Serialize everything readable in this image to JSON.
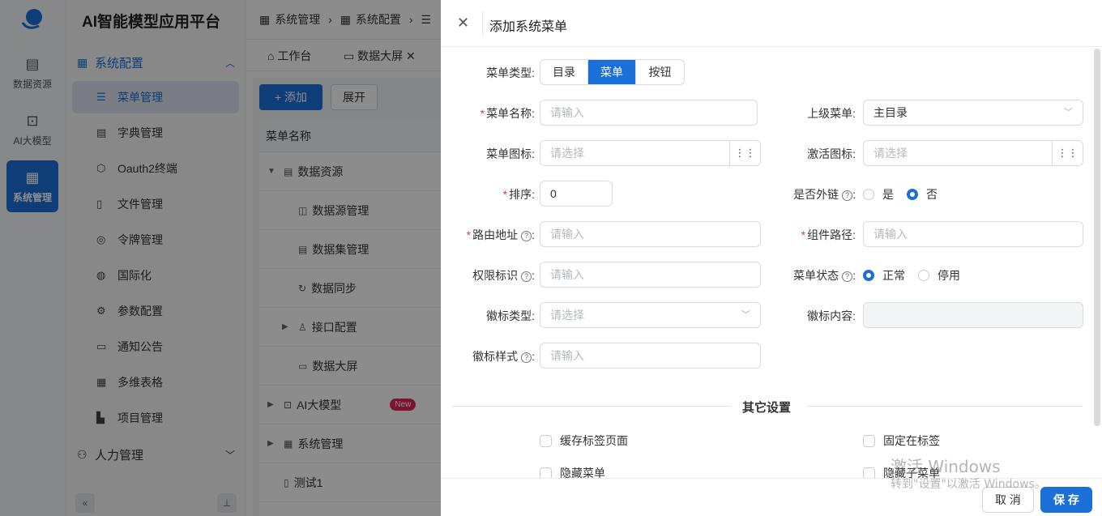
{
  "app": {
    "title": "AI智能模型应用平台"
  },
  "rail": [
    {
      "label": "数据资源",
      "icon": "database-icon"
    },
    {
      "label": "AI大模型",
      "icon": "ai-icon"
    },
    {
      "label": "系统管理",
      "icon": "system-icon",
      "active": true
    }
  ],
  "sidebar": {
    "group_system": "系统配置",
    "items": [
      {
        "label": "菜单管理",
        "icon": "menu-list-icon",
        "active": true
      },
      {
        "label": "字典管理",
        "icon": "dictionary-icon"
      },
      {
        "label": "Oauth2终端",
        "icon": "hexagon-icon"
      },
      {
        "label": "文件管理",
        "icon": "file-icon"
      },
      {
        "label": "令牌管理",
        "icon": "token-icon"
      },
      {
        "label": "国际化",
        "icon": "globe-icon"
      },
      {
        "label": "参数配置",
        "icon": "settings-icon"
      },
      {
        "label": "通知公告",
        "icon": "message-icon"
      },
      {
        "label": "多维表格",
        "icon": "table-icon"
      },
      {
        "label": "项目管理",
        "icon": "project-icon"
      }
    ],
    "group_hr": "人力管理"
  },
  "breadcrumb": [
    "系统管理",
    "系统配置"
  ],
  "tabs": [
    "工作台",
    "数据大屏"
  ],
  "toolbar": {
    "add": "+ 添加",
    "expand": "展开"
  },
  "table": {
    "header": "菜单名称",
    "rows": [
      {
        "label": "数据资源",
        "level": 0,
        "expanded": true
      },
      {
        "label": "数据源管理",
        "level": 1
      },
      {
        "label": "数据集管理",
        "level": 1
      },
      {
        "label": "数据同步",
        "level": 1
      },
      {
        "label": "接口配置",
        "level": 1,
        "collapsed": true
      },
      {
        "label": "数据大屏",
        "level": 1
      },
      {
        "label": "AI大模型",
        "level": 0,
        "badge": "New"
      },
      {
        "label": "系统管理",
        "level": 0
      },
      {
        "label": "测试1",
        "level": 0
      }
    ]
  },
  "drawer": {
    "title": "添加系统菜单",
    "menu_type": {
      "label": "菜单类型:",
      "options": [
        "目录",
        "菜单",
        "按钮"
      ],
      "selected": "菜单"
    },
    "menu_name": {
      "label": "菜单名称:",
      "placeholder": "请输入"
    },
    "parent_menu": {
      "label": "上级菜单:",
      "value": "主目录"
    },
    "menu_icon": {
      "label": "菜单图标:",
      "placeholder": "请选择"
    },
    "active_icon": {
      "label": "激活图标:",
      "placeholder": "请选择"
    },
    "sort": {
      "label": "排序:",
      "value": "0"
    },
    "external_link": {
      "label": "是否外链",
      "options": [
        "是",
        "否"
      ],
      "selected": "否"
    },
    "route": {
      "label": "路由地址",
      "placeholder": "请输入"
    },
    "component": {
      "label": "组件路径:",
      "placeholder": "请输入"
    },
    "permission": {
      "label": "权限标识",
      "placeholder": "请输入"
    },
    "menu_status": {
      "label": "菜单状态",
      "options": [
        "正常",
        "停用"
      ],
      "selected": "正常"
    },
    "badge_type": {
      "label": "徽标类型:",
      "placeholder": "请选择"
    },
    "badge_content": {
      "label": "徽标内容:"
    },
    "badge_style": {
      "label": "徽标样式",
      "placeholder": "请输入"
    },
    "other_settings": "其它设置",
    "checkboxes": [
      "缓存标签页面",
      "固定在标签",
      "隐藏菜单",
      "隐藏子菜单"
    ],
    "cancel": "取 消",
    "save": "保 存"
  },
  "watermark": {
    "line1": "激活 Windows",
    "line2": "转到\"设置\"以激活 Windows。"
  }
}
